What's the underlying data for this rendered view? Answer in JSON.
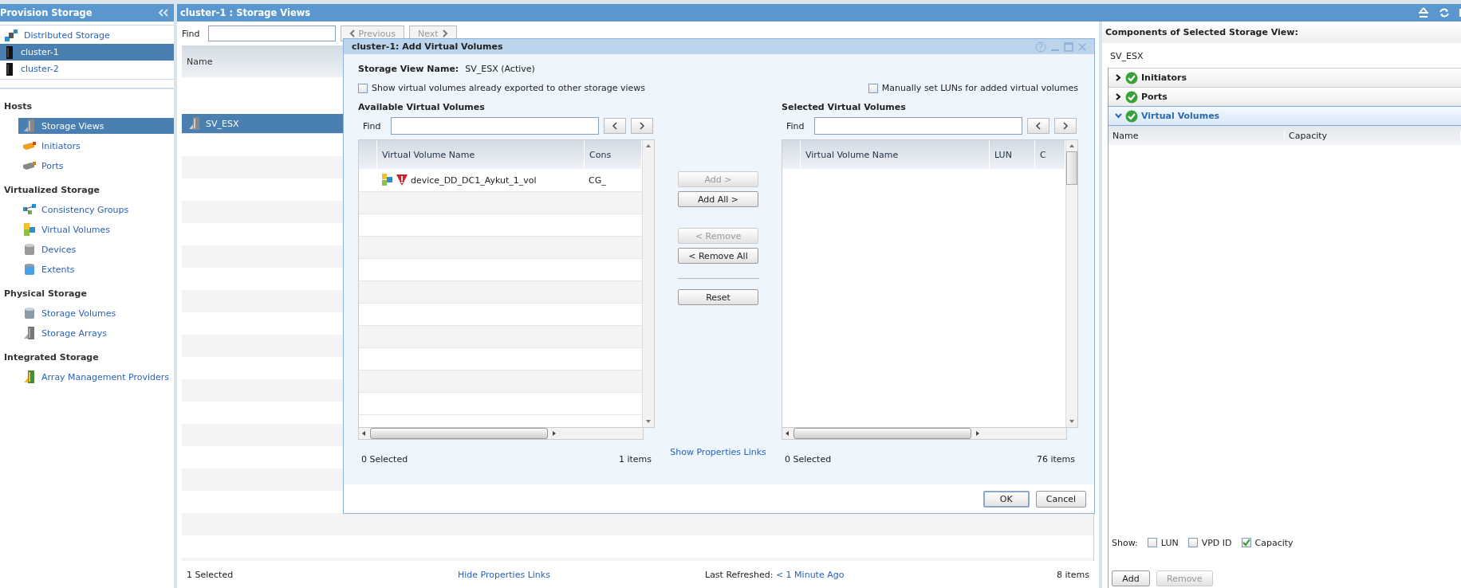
{
  "left_panel": {
    "title": "Provision Storage",
    "clusters": [
      {
        "label": "Distributed Storage",
        "kind": "distributed",
        "selected": false
      },
      {
        "label": "cluster-1",
        "kind": "cluster",
        "selected": true
      },
      {
        "label": "cluster-2",
        "kind": "cluster",
        "selected": false
      }
    ],
    "sections": [
      {
        "title": "Hosts",
        "items": [
          {
            "label": "Storage Views",
            "kind": "storage-view",
            "selected": true
          },
          {
            "label": "Initiators",
            "kind": "initiator",
            "selected": false
          },
          {
            "label": "Ports",
            "kind": "port",
            "selected": false
          }
        ]
      },
      {
        "title": "Virtualized Storage",
        "items": [
          {
            "label": "Consistency Groups",
            "kind": "group",
            "selected": false
          },
          {
            "label": "Virtual Volumes",
            "kind": "volume",
            "selected": false
          },
          {
            "label": "Devices",
            "kind": "device",
            "selected": false
          },
          {
            "label": "Extents",
            "kind": "extent",
            "selected": false
          }
        ]
      },
      {
        "title": "Physical Storage",
        "items": [
          {
            "label": "Storage Volumes",
            "kind": "disk",
            "selected": false
          },
          {
            "label": "Storage Arrays",
            "kind": "array",
            "selected": false
          }
        ]
      },
      {
        "title": "Integrated Storage",
        "items": [
          {
            "label": "Array Management Providers",
            "kind": "provider",
            "selected": false
          }
        ]
      }
    ]
  },
  "main_panel": {
    "title": "cluster-1 : Storage Views",
    "find_label": "Find",
    "previous": {
      "label": "Previous",
      "disabled": true
    },
    "next": {
      "label": "Next",
      "disabled": true
    },
    "columns": [
      "Name"
    ],
    "rows": [
      {
        "name": "SV_ESX",
        "selected": true
      }
    ],
    "status_bar": {
      "selected": "1 Selected",
      "link": "Hide Properties Links",
      "refreshed_label": "Last Refreshed:",
      "refreshed_value": "< 1 Minute Ago",
      "count": "8 items"
    }
  },
  "dialog": {
    "title": "cluster-1: Add Virtual Volumes",
    "name_label": "Storage View Name:",
    "name_value": "SV_ESX (Active)",
    "show_exported": {
      "label": "Show virtual volumes already exported to other storage views",
      "checked": false
    },
    "manual_luns": {
      "label": "Manually set LUNs for added virtual volumes",
      "checked": false
    },
    "available": {
      "title": "Available Virtual Volumes",
      "find_label": "Find",
      "columns": [
        "Virtual Volume Name",
        "Cons"
      ],
      "rows": [
        {
          "cells": [
            "device_DD_DC1_Aykut_1_vol",
            "CG_"
          ],
          "warning": true
        }
      ],
      "selected_count": "0 Selected",
      "count": "1 items"
    },
    "selected": {
      "title": "Selected Virtual Volumes",
      "find_label": "Find",
      "columns": [
        "Virtual Volume Name",
        "LUN",
        "C"
      ],
      "selected_count": "0 Selected",
      "count": "76 items"
    },
    "button_groups": [
      {
        "buttons": [
          {
            "label": "Add >",
            "disabled": true
          },
          {
            "label": "Add All >",
            "disabled": false
          }
        ]
      },
      {
        "buttons": [
          {
            "label": "< Remove",
            "disabled": true
          },
          {
            "label": "< Remove All",
            "disabled": false
          }
        ]
      },
      {
        "buttons": [
          {
            "label": "Reset",
            "disabled": false
          }
        ]
      }
    ],
    "link": "Show Properties Links",
    "actions": [
      {
        "label": "OK",
        "primary": true
      },
      {
        "label": "Cancel",
        "primary": false
      }
    ]
  },
  "components_panel": {
    "title": "Components of Selected Storage View:",
    "view_name": "SV_ESX",
    "sections": [
      {
        "label": "Initiators",
        "expanded": false
      },
      {
        "label": "Ports",
        "expanded": false
      },
      {
        "label": "Virtual Volumes",
        "expanded": true
      }
    ],
    "columns": [
      "Name",
      "Capacity"
    ],
    "show_label": "Show:",
    "options": [
      {
        "label": "LUN",
        "checked": false
      },
      {
        "label": "VPD ID",
        "checked": false
      },
      {
        "label": "Capacity",
        "checked": true
      }
    ],
    "buttons": [
      {
        "label": "Add",
        "disabled": false
      },
      {
        "label": "Remove",
        "disabled": true
      }
    ]
  }
}
